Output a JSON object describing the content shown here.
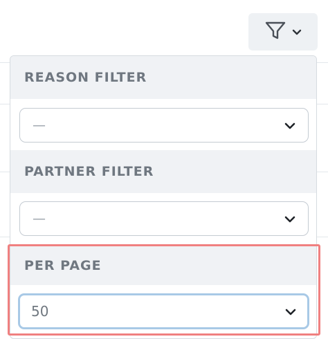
{
  "filter_toggle": {
    "icon": "funnel-icon",
    "chevron": "chevron-down-icon"
  },
  "filters": [
    {
      "label": "REASON FILTER",
      "selected": "—"
    },
    {
      "label": "PARTNER FILTER",
      "selected": "—"
    },
    {
      "label": "PER PAGE",
      "selected": "50"
    }
  ],
  "colors": {
    "highlight_border": "#f08080",
    "focus_ring": "#a8c9e6",
    "header_bg": "#f0f2f5"
  }
}
